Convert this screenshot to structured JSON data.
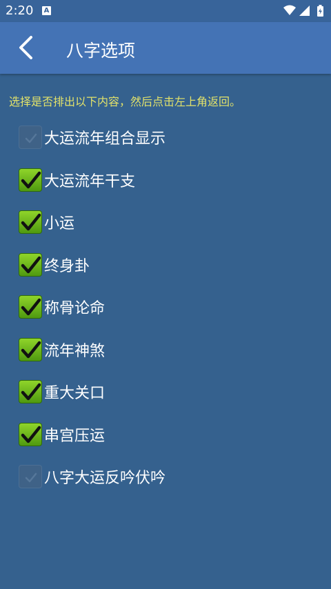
{
  "status_bar": {
    "time": "2:20",
    "notification_icon": "A",
    "icons": [
      "wifi-icon",
      "signal-icon",
      "battery-charging-icon"
    ]
  },
  "app_bar": {
    "back_icon": "chevron-left-icon",
    "title": "八字选项"
  },
  "instruction": "选择是否排出以下内容，然后点击左上角返回。",
  "options": [
    {
      "label": "大运流年组合显示",
      "checked": false
    },
    {
      "label": "大运流年干支",
      "checked": true
    },
    {
      "label": "小运",
      "checked": true
    },
    {
      "label": "终身卦",
      "checked": true
    },
    {
      "label": "称骨论命",
      "checked": true
    },
    {
      "label": "流年神煞",
      "checked": true
    },
    {
      "label": "重大关口",
      "checked": true
    },
    {
      "label": "串宫压运",
      "checked": true
    },
    {
      "label": "八字大运反吟伏吟",
      "checked": false
    }
  ],
  "colors": {
    "background": "#35618e",
    "app_bar": "#4473b5",
    "instruction_text": "#e2e26a",
    "check_green": "#6fbf1a"
  }
}
